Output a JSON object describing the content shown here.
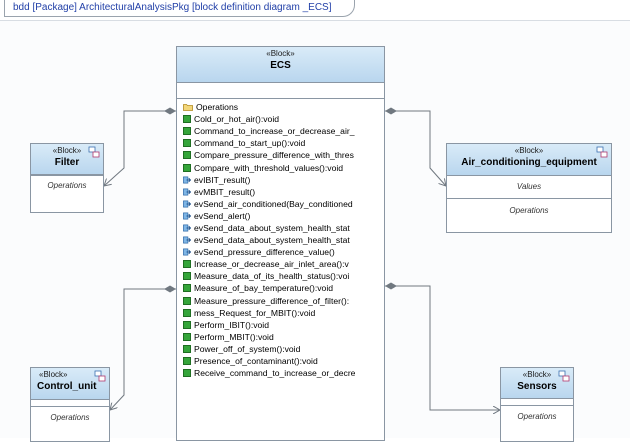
{
  "frame": {
    "title": "bdd [Package] ArchitecturalAnalysisPkg [block definition diagram _ECS]"
  },
  "colors": {
    "header_gradient_top": "#d9ebf8",
    "header_gradient_bottom": "#b9d6ee",
    "border": "#8a96a3",
    "operation_icon": "#35a53a",
    "frame_title": "#2240a8"
  },
  "blocks": {
    "ecs": {
      "stereotype": "«Block»",
      "name": "ECS",
      "compartment_label": "Operations",
      "operations": [
        {
          "kind": "op",
          "label": "Cold_or_hot_air():void"
        },
        {
          "kind": "op",
          "label": "Command_to_increase_or_decrease_air_"
        },
        {
          "kind": "op",
          "label": "Command_to_start_up():void"
        },
        {
          "kind": "op",
          "label": "Compare_pressure_difference_with_thres"
        },
        {
          "kind": "op",
          "label": "Compare_with_threshold_values():void"
        },
        {
          "kind": "rx",
          "label": "evIBIT_result()"
        },
        {
          "kind": "rx",
          "label": "evMBIT_result()"
        },
        {
          "kind": "rx",
          "label": "evSend_air_conditioned(Bay_conditioned"
        },
        {
          "kind": "rx",
          "label": "evSend_alert()"
        },
        {
          "kind": "rx",
          "label": "evSend_data_about_system_health_stat"
        },
        {
          "kind": "rx",
          "label": "evSend_data_about_system_health_stat"
        },
        {
          "kind": "rx",
          "label": "evSend_pressure_difference_value()"
        },
        {
          "kind": "op",
          "label": "Increase_or_decrease_air_inlet_area():v"
        },
        {
          "kind": "op",
          "label": "Measure_data_of_its_health_status():voi"
        },
        {
          "kind": "op",
          "label": "Measure_of_bay_temperature():void"
        },
        {
          "kind": "op",
          "label": "Measure_pressure_difference_of_filter():"
        },
        {
          "kind": "op",
          "label": "mess_Request_for_MBIT():void"
        },
        {
          "kind": "op",
          "label": "Perform_IBIT():void"
        },
        {
          "kind": "op",
          "label": "Perform_MBIT():void"
        },
        {
          "kind": "op",
          "label": "Power_off_of_system():void"
        },
        {
          "kind": "op",
          "label": "Presence_of_contaminant():void"
        },
        {
          "kind": "op",
          "label": "Receive_command_to_increase_or_decre"
        }
      ]
    },
    "filter": {
      "stereotype": "«Block»",
      "name": "Filter",
      "compartment_label": "Operations",
      "icon": "block-icon"
    },
    "air_conditioning": {
      "stereotype": "«Block»",
      "name": "Air_conditioning_equipment",
      "values_label": "Values",
      "compartment_label": "Operations",
      "icon": "block-icon"
    },
    "control_unit": {
      "stereotype": "«Block»",
      "name": "Control_unit",
      "compartment_label": "Operations",
      "icon": "block-icon"
    },
    "sensors": {
      "stereotype": "«Block»",
      "name": "Sensors",
      "compartment_label": "Operations",
      "icon": "block-icon"
    }
  }
}
